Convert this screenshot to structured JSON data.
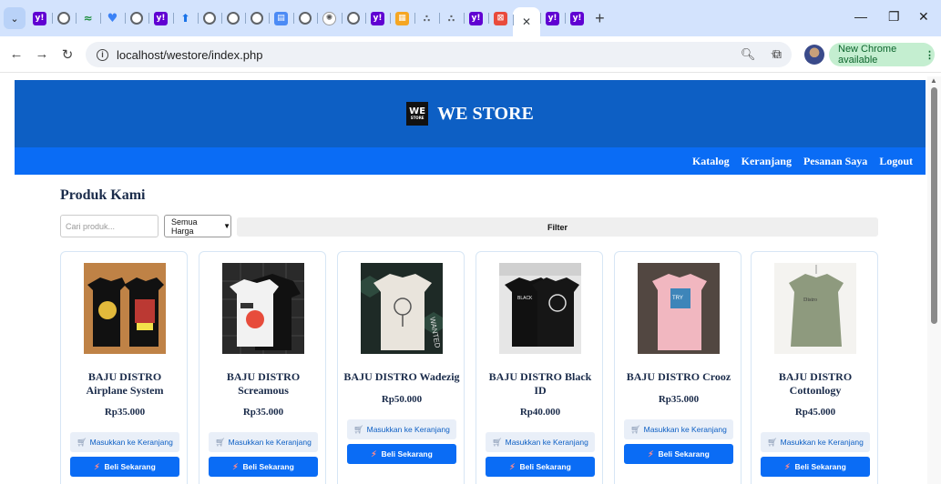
{
  "browser": {
    "url": "localhost/westore/index.php",
    "update_label": "New Chrome available"
  },
  "site": {
    "brand": "WE STORE",
    "logo_text": "WE",
    "logo_sub": "STORE",
    "nav": [
      "Katalog",
      "Keranjang",
      "Pesanan Saya",
      "Logout"
    ],
    "section_title": "Produk Kami",
    "search_placeholder": "Cari produk...",
    "price_select": "Semua Harga",
    "filter_label": "Filter",
    "cart_label": "Masukkan ke Keranjang",
    "buy_label": "Beli Sekarang"
  },
  "products": [
    {
      "name": "BAJU DISTRO Airplane System",
      "price": "Rp35.000"
    },
    {
      "name": "BAJU DISTRO Screamous",
      "price": "Rp35.000"
    },
    {
      "name": "BAJU DISTRO Wadezig",
      "price": "Rp50.000"
    },
    {
      "name": "BAJU DISTRO Black ID",
      "price": "Rp40.000"
    },
    {
      "name": "BAJU DISTRO Crooz",
      "price": "Rp35.000"
    },
    {
      "name": "BAJU DISTRO Cottonlogy",
      "price": "Rp45.000"
    }
  ],
  "icons": {
    "cart": "cart-icon",
    "bolt": "lightning-icon"
  }
}
